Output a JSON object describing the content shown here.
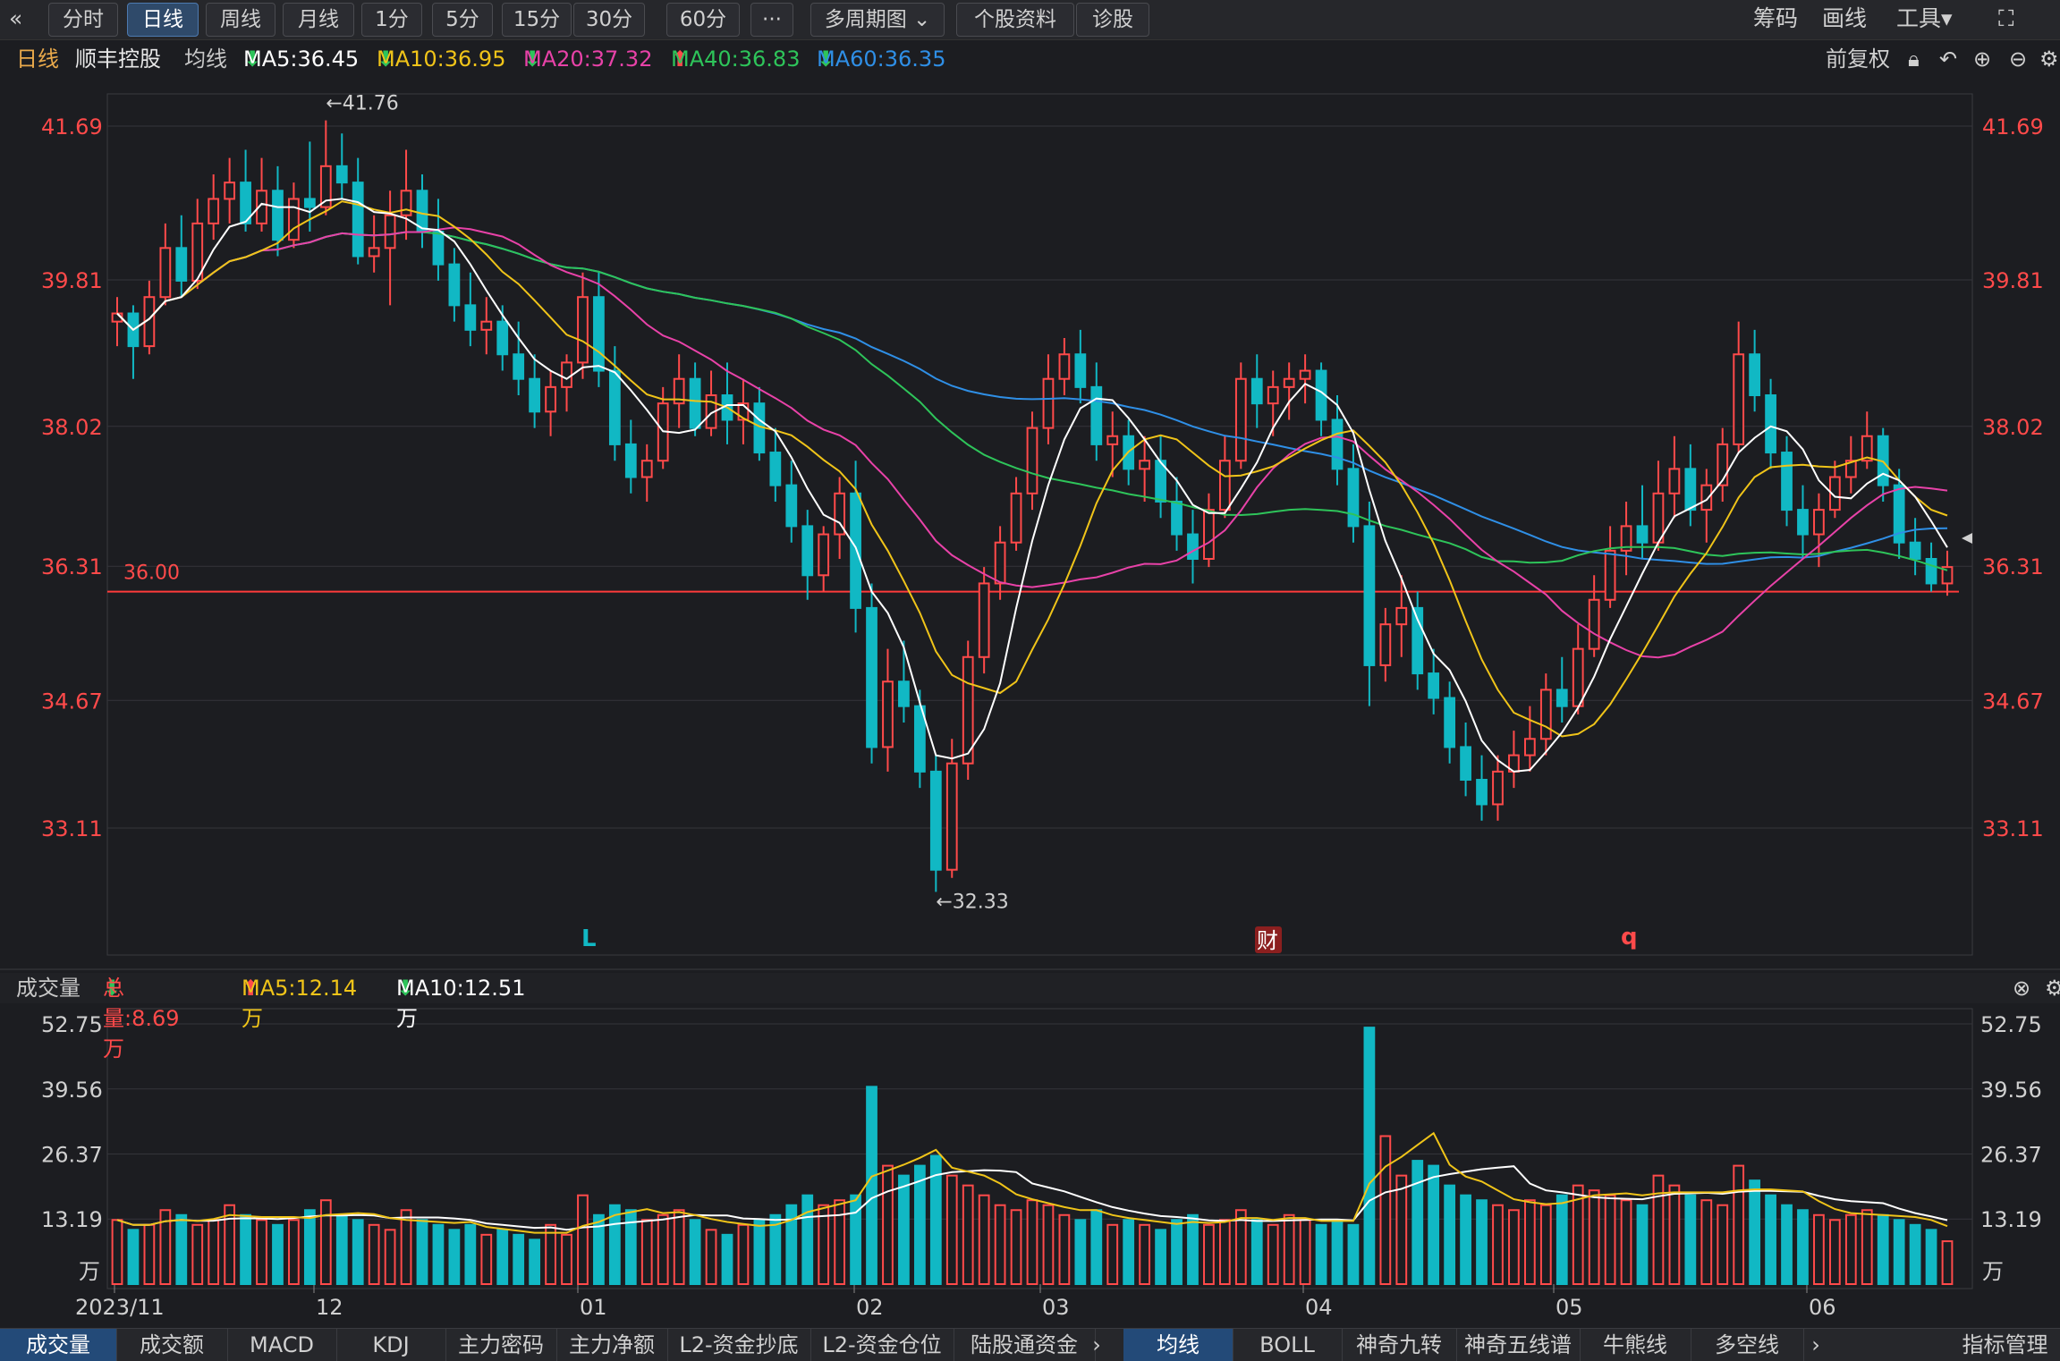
{
  "toolbar": {
    "back_icon": "double-chevron-left-icon",
    "periods": [
      "分时",
      "日线",
      "周线",
      "月线",
      "1分",
      "5分",
      "15分",
      "30分",
      "60分"
    ],
    "active_period": "日线",
    "more": "···",
    "multi_period": "多周期图",
    "profile": "个股资料",
    "diagnose": "诊股",
    "chips": "筹码",
    "draw": "画线",
    "tools": "工具",
    "fullscreen_icon": "expand-icon"
  },
  "info": {
    "period": "日线",
    "stock": "顺丰控股",
    "avg_label": "均线",
    "ma5": "MA5:36.45",
    "ma10": "MA10:36.95",
    "ma20": "MA20:37.32",
    "ma40": "MA40:36.83",
    "ma60": "MA60:36.35",
    "adjust": "前复权"
  },
  "price_axis": {
    "ticks": [
      "41.69",
      "39.81",
      "38.02",
      "36.31",
      "34.67",
      "33.11"
    ],
    "high_label": "←41.76",
    "low_label": "←32.33",
    "line_label": "36.00"
  },
  "markers": {
    "m1": "L",
    "m2": "财",
    "m3": "q"
  },
  "volume": {
    "title": "成交量",
    "total": "总量:8.69万",
    "ma5": "MA5:12.14万",
    "ma10": "MA10:12.51万",
    "ticks": [
      "52.75",
      "39.56",
      "26.37",
      "13.19"
    ],
    "unit": "万"
  },
  "date_axis": [
    "2023/11",
    "12",
    "01",
    "02",
    "03",
    "04",
    "05",
    "06"
  ],
  "bottom_tabs": [
    "成交量",
    "成交额",
    "MACD",
    "KDJ",
    "主力密码",
    "主力净额",
    "L2-资金抄底",
    "L2-资金仓位",
    "陆股通资金"
  ],
  "bottom_tabs_right": [
    "均线",
    "BOLL",
    "神奇九转",
    "神奇五线谱",
    "牛熊线",
    "多空线"
  ],
  "indicator_manage": "指标管理",
  "colors": {
    "up": "#ff4a4a",
    "down": "#11b8c4",
    "ma5": "#ffffff",
    "ma10": "#f0c419",
    "ma20": "#e842a8",
    "ma40": "#2ec45a",
    "ma60": "#2f8fe6"
  },
  "chart_data": {
    "type": "candlestick",
    "price_ylim": [
      32.33,
      41.76
    ],
    "price_ticks": [
      41.69,
      39.81,
      38.02,
      36.31,
      34.67,
      33.11
    ],
    "volume_ylim_wan": [
      0,
      52.75
    ],
    "volume_ticks_wan": [
      52.75,
      39.56,
      26.37,
      13.19
    ],
    "reference_line": 36.0,
    "high": 41.76,
    "low": 32.33,
    "ohlcv": [
      [
        39.3,
        39.6,
        39.0,
        39.4,
        13
      ],
      [
        39.4,
        39.5,
        38.6,
        39.0,
        11
      ],
      [
        39.0,
        39.8,
        38.9,
        39.6,
        12
      ],
      [
        39.6,
        40.5,
        39.5,
        40.2,
        15
      ],
      [
        40.2,
        40.6,
        39.6,
        39.8,
        14
      ],
      [
        39.8,
        40.8,
        39.7,
        40.5,
        12
      ],
      [
        40.5,
        41.1,
        40.3,
        40.8,
        13
      ],
      [
        40.8,
        41.3,
        40.5,
        41.0,
        16
      ],
      [
        41.0,
        41.4,
        40.4,
        40.5,
        14
      ],
      [
        40.5,
        41.3,
        40.4,
        40.9,
        13
      ],
      [
        40.9,
        41.2,
        40.1,
        40.3,
        12
      ],
      [
        40.3,
        41.0,
        40.2,
        40.8,
        13
      ],
      [
        40.8,
        41.5,
        40.4,
        40.7,
        15
      ],
      [
        40.7,
        41.76,
        40.6,
        41.2,
        17
      ],
      [
        41.2,
        41.6,
        40.8,
        41.0,
        14
      ],
      [
        41.0,
        41.3,
        40.0,
        40.1,
        13
      ],
      [
        40.1,
        40.6,
        39.9,
        40.2,
        12
      ],
      [
        40.2,
        40.9,
        39.5,
        40.6,
        11
      ],
      [
        40.6,
        41.4,
        40.3,
        40.9,
        15
      ],
      [
        40.9,
        41.1,
        40.2,
        40.4,
        13
      ],
      [
        40.4,
        40.8,
        39.8,
        40.0,
        12
      ],
      [
        40.0,
        40.2,
        39.3,
        39.5,
        11
      ],
      [
        39.5,
        39.9,
        39.0,
        39.2,
        12
      ],
      [
        39.2,
        39.6,
        38.9,
        39.3,
        10
      ],
      [
        39.3,
        39.5,
        38.7,
        38.9,
        11
      ],
      [
        38.9,
        39.3,
        38.4,
        38.6,
        10
      ],
      [
        38.6,
        38.9,
        38.0,
        38.2,
        9
      ],
      [
        38.2,
        38.7,
        37.9,
        38.5,
        12
      ],
      [
        38.5,
        38.9,
        38.2,
        38.8,
        10
      ],
      [
        38.8,
        39.9,
        38.6,
        39.6,
        18
      ],
      [
        39.6,
        39.9,
        38.5,
        38.7,
        14
      ],
      [
        38.7,
        39.0,
        37.6,
        37.8,
        16
      ],
      [
        37.8,
        38.1,
        37.2,
        37.4,
        15
      ],
      [
        37.4,
        37.8,
        37.1,
        37.6,
        13
      ],
      [
        37.6,
        38.5,
        37.5,
        38.3,
        14
      ],
      [
        38.3,
        38.9,
        38.0,
        38.6,
        15
      ],
      [
        38.6,
        38.8,
        37.9,
        38.0,
        13
      ],
      [
        38.0,
        38.7,
        37.9,
        38.4,
        11
      ],
      [
        38.4,
        38.8,
        37.8,
        38.1,
        10
      ],
      [
        38.1,
        38.6,
        37.8,
        38.3,
        12
      ],
      [
        38.3,
        38.5,
        37.6,
        37.7,
        13
      ],
      [
        37.7,
        38.0,
        37.1,
        37.3,
        14
      ],
      [
        37.3,
        37.6,
        36.6,
        36.8,
        16
      ],
      [
        36.8,
        37.0,
        35.9,
        36.2,
        18
      ],
      [
        36.2,
        36.8,
        36.0,
        36.7,
        16
      ],
      [
        36.7,
        37.4,
        36.4,
        37.2,
        17
      ],
      [
        37.2,
        37.6,
        35.5,
        35.8,
        18
      ],
      [
        35.8,
        36.1,
        33.9,
        34.1,
        40
      ],
      [
        34.1,
        35.3,
        33.8,
        34.9,
        24
      ],
      [
        34.9,
        35.4,
        34.4,
        34.6,
        22
      ],
      [
        34.6,
        34.8,
        33.6,
        33.8,
        24
      ],
      [
        33.8,
        34.0,
        32.33,
        32.6,
        26
      ],
      [
        32.6,
        34.2,
        32.5,
        33.9,
        22
      ],
      [
        33.9,
        35.4,
        33.7,
        35.2,
        20
      ],
      [
        35.2,
        36.3,
        35.0,
        36.1,
        18
      ],
      [
        36.1,
        36.8,
        35.9,
        36.6,
        16
      ],
      [
        36.6,
        37.4,
        36.5,
        37.2,
        15
      ],
      [
        37.2,
        38.2,
        37.0,
        38.0,
        17
      ],
      [
        38.0,
        38.9,
        37.8,
        38.6,
        16
      ],
      [
        38.6,
        39.1,
        38.4,
        38.9,
        14
      ],
      [
        38.9,
        39.2,
        38.3,
        38.5,
        13
      ],
      [
        38.5,
        38.8,
        37.6,
        37.8,
        15
      ],
      [
        37.8,
        38.2,
        37.4,
        37.9,
        12
      ],
      [
        37.9,
        38.1,
        37.3,
        37.5,
        13
      ],
      [
        37.5,
        37.9,
        37.1,
        37.6,
        12
      ],
      [
        37.6,
        37.9,
        36.9,
        37.1,
        11
      ],
      [
        37.1,
        37.4,
        36.5,
        36.7,
        13
      ],
      [
        36.7,
        37.0,
        36.1,
        36.4,
        14
      ],
      [
        36.4,
        37.2,
        36.3,
        37.0,
        12
      ],
      [
        37.0,
        37.9,
        36.9,
        37.6,
        13
      ],
      [
        37.6,
        38.8,
        37.5,
        38.6,
        15
      ],
      [
        38.6,
        38.9,
        38.0,
        38.3,
        13
      ],
      [
        38.3,
        38.7,
        37.9,
        38.5,
        12
      ],
      [
        38.5,
        38.8,
        38.1,
        38.6,
        14
      ],
      [
        38.6,
        38.9,
        38.3,
        38.7,
        13
      ],
      [
        38.7,
        38.8,
        37.9,
        38.1,
        12
      ],
      [
        38.1,
        38.4,
        37.3,
        37.5,
        13
      ],
      [
        37.5,
        37.8,
        36.6,
        36.8,
        12
      ],
      [
        36.8,
        37.1,
        34.6,
        35.1,
        52
      ],
      [
        35.1,
        35.8,
        34.9,
        35.6,
        30
      ],
      [
        35.6,
        36.2,
        35.2,
        35.8,
        22
      ],
      [
        35.8,
        36.0,
        34.8,
        35.0,
        25
      ],
      [
        35.0,
        35.3,
        34.5,
        34.7,
        24
      ],
      [
        34.7,
        34.9,
        33.9,
        34.1,
        20
      ],
      [
        34.1,
        34.4,
        33.5,
        33.7,
        18
      ],
      [
        33.7,
        34.0,
        33.2,
        33.4,
        17
      ],
      [
        33.4,
        34.0,
        33.2,
        33.8,
        16
      ],
      [
        33.8,
        34.3,
        33.6,
        34.0,
        15
      ],
      [
        34.0,
        34.6,
        33.8,
        34.2,
        17
      ],
      [
        34.2,
        35.0,
        34.0,
        34.8,
        16
      ],
      [
        34.8,
        35.2,
        34.4,
        34.6,
        18
      ],
      [
        34.6,
        35.6,
        34.5,
        35.3,
        20
      ],
      [
        35.3,
        36.2,
        35.2,
        35.9,
        19
      ],
      [
        35.9,
        36.8,
        35.8,
        36.5,
        18
      ],
      [
        36.5,
        37.1,
        36.2,
        36.8,
        17
      ],
      [
        36.8,
        37.3,
        36.4,
        36.6,
        16
      ],
      [
        36.6,
        37.6,
        36.5,
        37.2,
        22
      ],
      [
        37.2,
        37.9,
        36.9,
        37.5,
        20
      ],
      [
        37.5,
        37.8,
        36.8,
        37.0,
        18
      ],
      [
        37.0,
        37.5,
        36.6,
        37.3,
        17
      ],
      [
        37.3,
        38.0,
        37.1,
        37.8,
        16
      ],
      [
        37.8,
        39.3,
        37.7,
        38.9,
        24
      ],
      [
        38.9,
        39.2,
        38.2,
        38.4,
        21
      ],
      [
        38.4,
        38.6,
        37.5,
        37.7,
        18
      ],
      [
        37.7,
        37.9,
        36.8,
        37.0,
        16
      ],
      [
        37.0,
        37.3,
        36.4,
        36.7,
        15
      ],
      [
        36.7,
        37.2,
        36.3,
        37.0,
        14
      ],
      [
        37.0,
        37.6,
        36.9,
        37.4,
        13
      ],
      [
        37.4,
        37.9,
        37.2,
        37.6,
        14
      ],
      [
        37.6,
        38.2,
        37.5,
        37.9,
        15
      ],
      [
        37.9,
        38.0,
        37.1,
        37.3,
        14
      ],
      [
        37.3,
        37.5,
        36.4,
        36.6,
        13
      ],
      [
        36.6,
        36.9,
        36.2,
        36.4,
        12
      ],
      [
        36.4,
        36.6,
        36.0,
        36.1,
        11
      ],
      [
        36.1,
        36.5,
        35.95,
        36.3,
        8.69
      ]
    ]
  }
}
